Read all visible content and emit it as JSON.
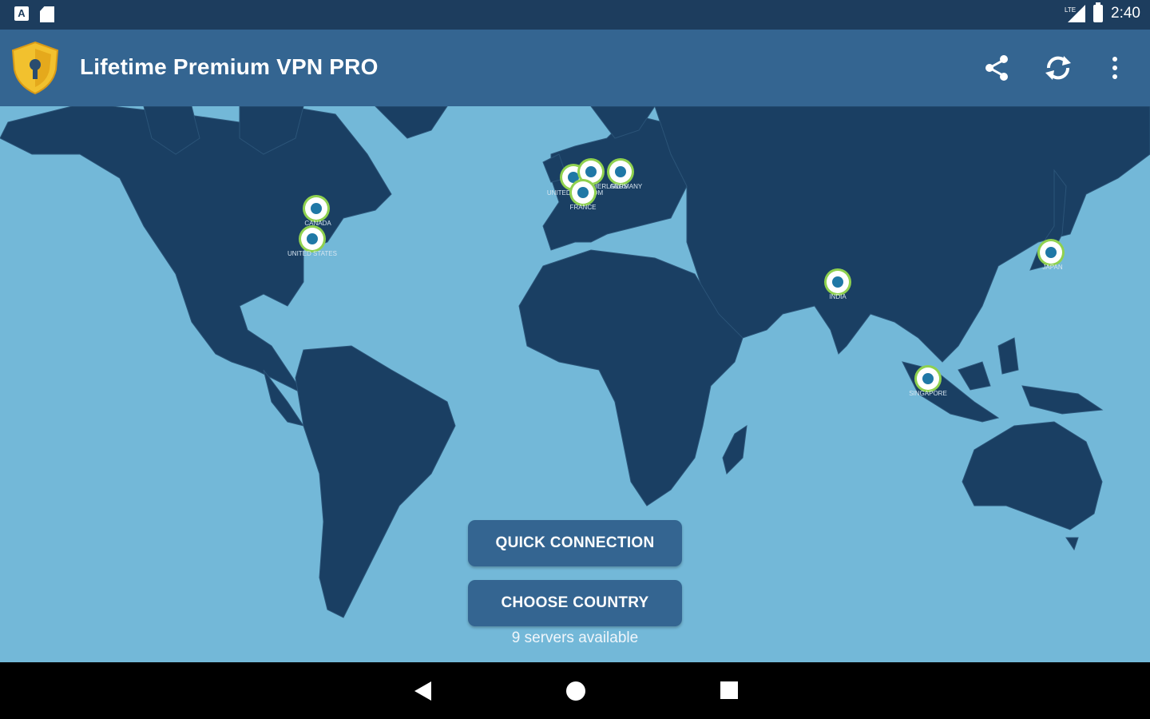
{
  "status_bar": {
    "time": "2:40",
    "left_icons": [
      "a-notification-icon",
      "sd-card-icon"
    ],
    "right_icons": [
      "lte-signal-icon",
      "battery-icon"
    ],
    "lte_label": "LTE"
  },
  "app_bar": {
    "title": "Lifetime Premium VPN PRO",
    "icons": [
      "shield-keyhole-logo-icon",
      "share-icon",
      "refresh-icon",
      "overflow-menu-icon"
    ],
    "bg_color": "#346591",
    "logo_color": "#f2c12e"
  },
  "map": {
    "ocean_color": "#73b8d8",
    "land_color": "#1a3f63",
    "pin_ring_color": "#8fd14f",
    "servers": [
      {
        "label": "CANADA"
      },
      {
        "label": "UNITED STATES"
      },
      {
        "label": "UNITED KINGDOM"
      },
      {
        "label": "NETHERLANDS"
      },
      {
        "label": "FRANCE"
      },
      {
        "label": "GERMANY"
      },
      {
        "label": "INDIA"
      },
      {
        "label": "SINGAPORE"
      },
      {
        "label": "JAPAN"
      }
    ]
  },
  "actions": {
    "quick_connection": "QUICK CONNECTION",
    "choose_country": "CHOOSE COUNTRY",
    "servers_available": "9 servers available"
  },
  "nav_bar": {
    "icons": [
      "back-icon",
      "home-icon",
      "recents-icon"
    ]
  }
}
